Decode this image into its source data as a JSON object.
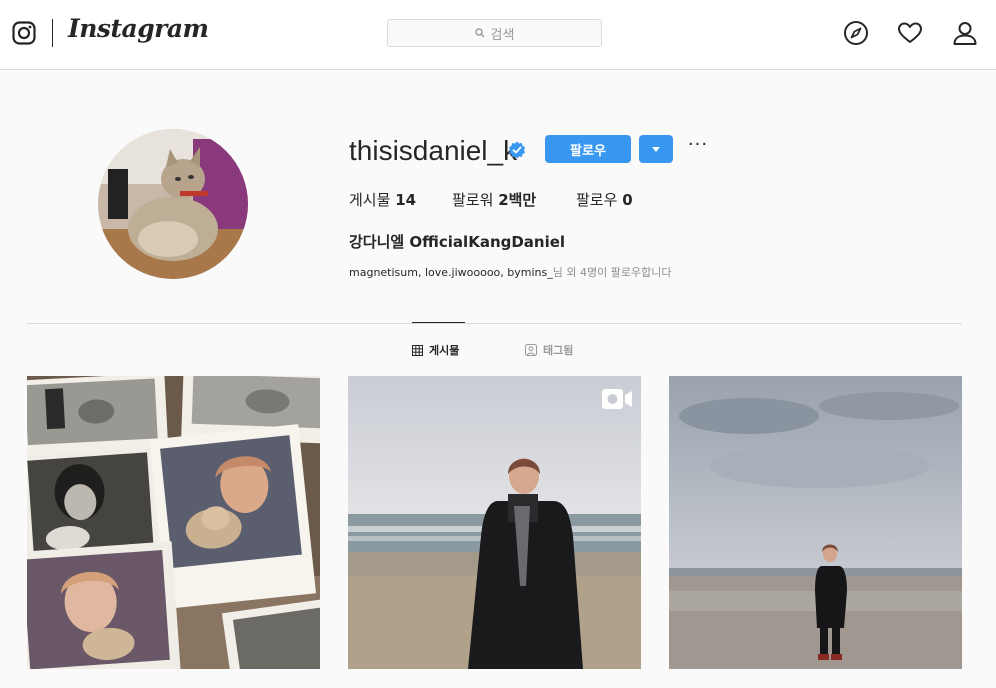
{
  "nav": {
    "brand": "Instagram",
    "search_placeholder": "검색",
    "icons": [
      "instagram-glyph-icon",
      "compass-icon",
      "heart-icon",
      "person-icon"
    ]
  },
  "profile": {
    "username": "thisisdaniel_k",
    "verified": true,
    "follow_label": "팔로우",
    "more_label": "···",
    "stats": {
      "posts_label": "게시물",
      "posts_value": "14",
      "followers_label": "팔로워",
      "followers_value": "2백만",
      "following_label": "팔로우",
      "following_value": "0"
    },
    "full_name": "강다니엘 OfficialKangDaniel",
    "followed_by_names": "magnetisum, love.jiwooooo, bymins_",
    "followed_by_suffix": "님 외 4명이 팔로우합니다"
  },
  "tabs": [
    {
      "label": "게시물",
      "icon": "grid-icon",
      "active": true
    },
    {
      "label": "태그됨",
      "icon": "tagged-icon",
      "active": false
    }
  ],
  "posts": [
    {
      "alt": "polaroid photos with cat",
      "video": false
    },
    {
      "alt": "man standing on beach",
      "video": true
    },
    {
      "alt": "man standing on wide beach",
      "video": false
    }
  ],
  "colors": {
    "accent": "#3897f0",
    "border": "#dbdbdb",
    "text": "#262626",
    "muted": "#8e8e8e"
  }
}
